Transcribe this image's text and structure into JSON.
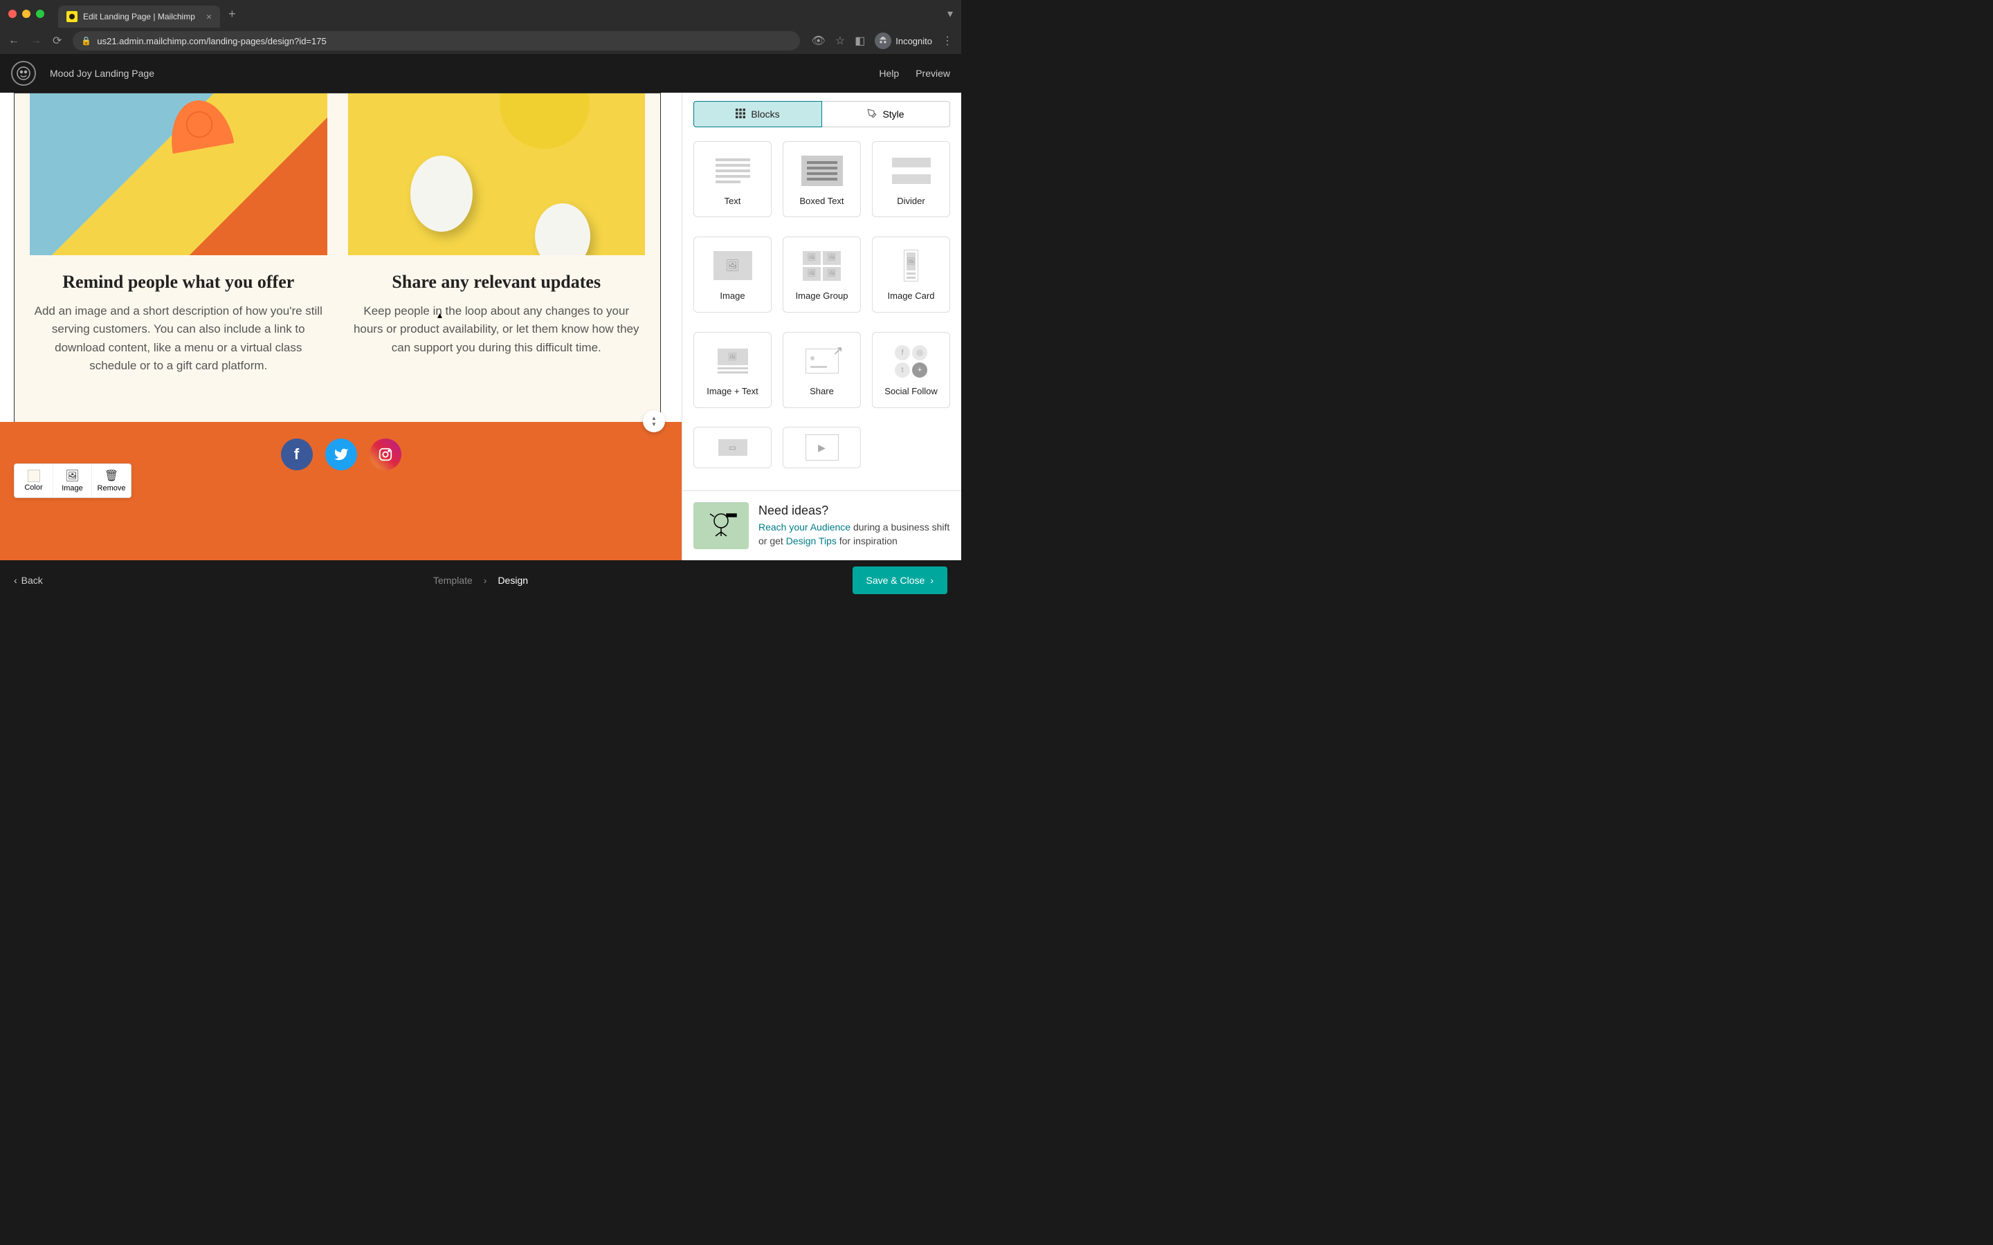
{
  "browser": {
    "tab_title": "Edit Landing Page | Mailchimp",
    "url": "us21.admin.mailchimp.com/landing-pages/design?id=175",
    "incognito_label": "Incognito"
  },
  "header": {
    "page_title": "Mood Joy Landing Page",
    "help": "Help",
    "preview": "Preview"
  },
  "canvas": {
    "columns": [
      {
        "heading": "Remind people what you offer",
        "body": "Add an image and a short description of how you're still serving customers. You can also include a link to download content, like a menu or a virtual class schedule or to a gift card platform."
      },
      {
        "heading": "Share any relevant updates",
        "body": "Keep people in the loop about any changes to your hours or product availability, or let them know how they can support you during this difficult time."
      }
    ],
    "toolbar": {
      "color": "Color",
      "image": "Image",
      "remove": "Remove"
    }
  },
  "panel": {
    "tabs": {
      "blocks": "Blocks",
      "style": "Style"
    },
    "blocks": [
      "Text",
      "Boxed Text",
      "Divider",
      "Image",
      "Image Group",
      "Image Card",
      "Image + Text",
      "Share",
      "Social Follow"
    ],
    "ideas": {
      "title": "Need ideas?",
      "link1": "Reach your Audience",
      "mid": " during a business shift or get ",
      "link2": "Design Tips",
      "tail": " for inspiration"
    }
  },
  "bottom": {
    "back": "Back",
    "crumb_template": "Template",
    "crumb_design": "Design",
    "save_close": "Save & Close"
  }
}
